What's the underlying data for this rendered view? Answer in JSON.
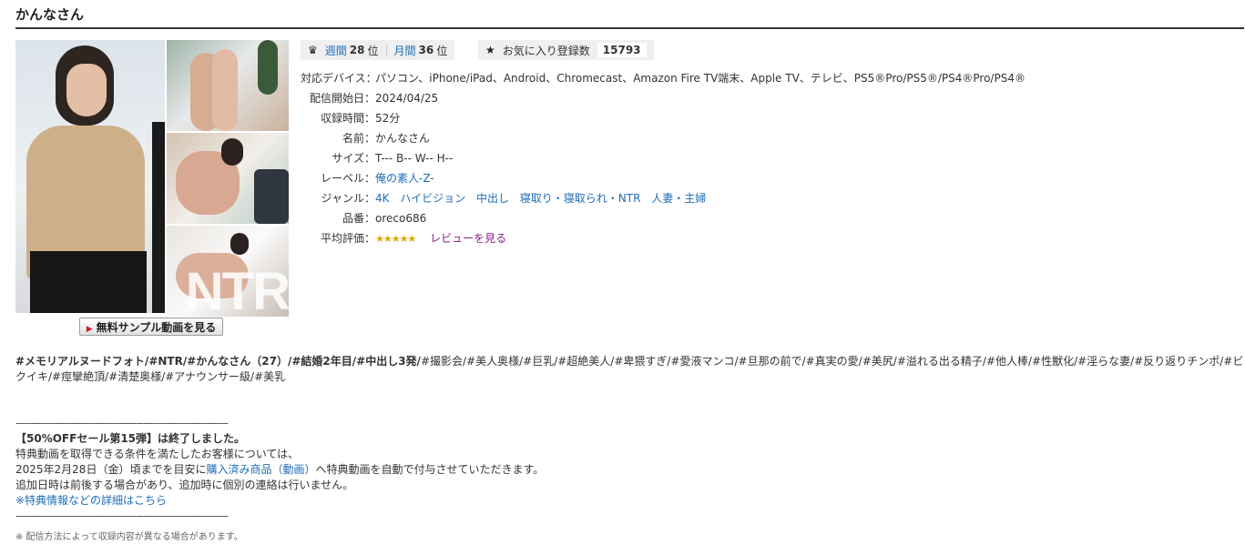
{
  "title": "かんなさん",
  "sample_button_label": "無料サンプル動画を見る",
  "ranking": {
    "weekly_label": "週間",
    "weekly_rank": "28",
    "monthly_label": "月間",
    "monthly_rank": "36",
    "rank_unit": "位",
    "favorites_label": "お気に入り登録数",
    "favorites_count": "15793"
  },
  "specs": {
    "devices_label": "対応デバイス：",
    "devices_value": "パソコン、iPhone/iPad、Android、Chromecast、Amazon Fire TV端末、Apple TV、テレビ、PS5®Pro/PS5®/PS4®Pro/PS4®",
    "release_label": "配信開始日：",
    "release_value": "2024/04/25",
    "duration_label": "収録時間：",
    "duration_value": "52分",
    "name_label": "名前：",
    "name_value": "かんなさん",
    "size_label": "サイズ：",
    "size_value": "T--- B-- W-- H--",
    "label_label": "レーベル：",
    "label_value": "俺の素人-Z-",
    "genre_label": "ジャンル：",
    "genres": [
      "4K",
      "ハイビジョン",
      "中出し",
      "寝取り・寝取られ・NTR",
      "人妻・主婦"
    ],
    "product_label": "品番：",
    "product_value": "oreco686",
    "rating_label": "平均評価：",
    "rating_stars": "★★★★★",
    "review_link": "レビューを見る"
  },
  "tags": {
    "bold_text": "#メモリアルヌードフォト/#NTR/#かんなさん（27）/#結婚2年目/#中出し3発/",
    "normal_text": "#撮影会/#美人奥様/#巨乳/#超絶美人/#卑猥すぎ/#愛液マンコ/#旦那の前で/#真実の愛/#美尻/#溢れる出る精子/#他人棒/#性獣化/#淫らな妻/#反り返りチンポ/#ビクイキ/#痙攣絶頂/#清楚奥様/#アナウンサー級/#美乳"
  },
  "notice": {
    "divider": "----------------------------------------------------------------------",
    "headline": "【50%OFFセール第15弾】は終了しました。",
    "line1": "特典動画を取得できる条件を満たしたお客様については、",
    "line2_before": "2025年2月28日（金）頃までを目安に",
    "line2_link": "購入済み商品（動画）",
    "line2_after": "へ特典動画を自動で付与させていただきます。",
    "line3": "追加日時は前後する場合があり、追加時に個別の連絡は行いません。",
    "details_link": "※特典情報などの詳細はこちら"
  },
  "footnote": "※ 配信方法によって収録内容が異なる場合があります。"
}
